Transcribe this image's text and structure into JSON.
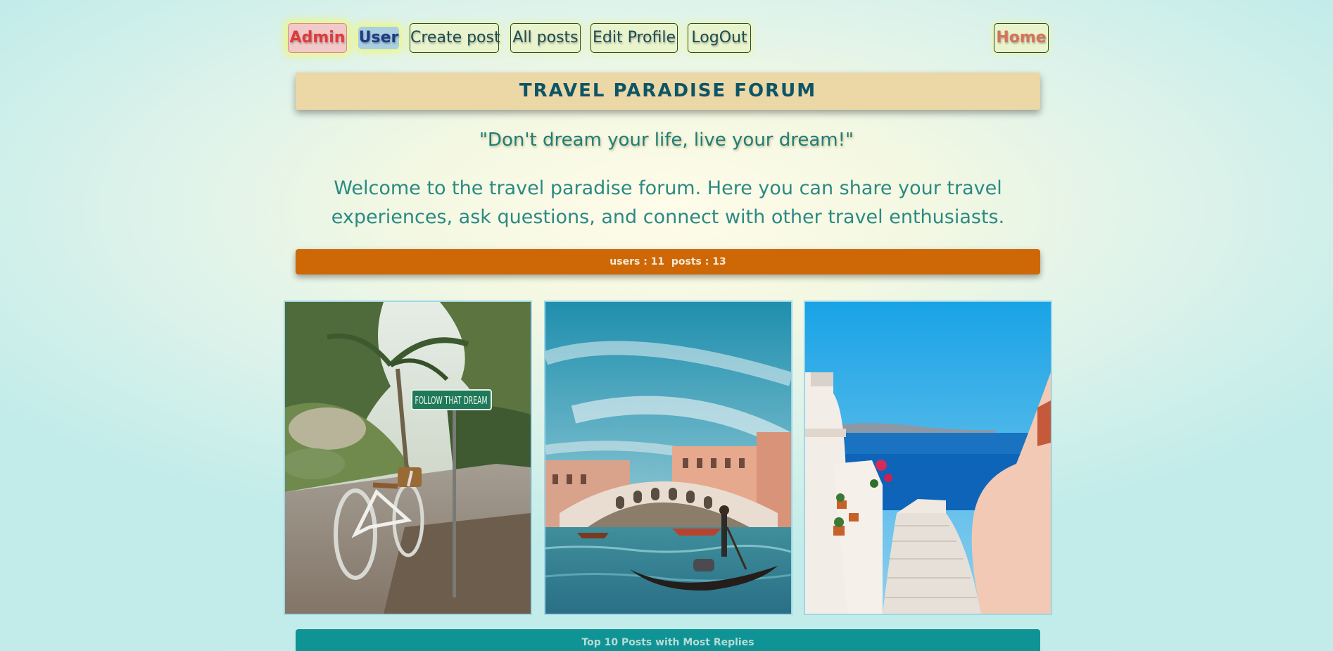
{
  "nav": {
    "admin": "Admin",
    "user": "User",
    "create_post": "Create post",
    "all_posts": "All posts",
    "edit_profile": "Edit Profile",
    "logout": "LogOut",
    "home": "Home"
  },
  "header": {
    "title": "TRAVEL PARADISE FORUM",
    "motto": "\"Don't dream your life, live your dream!\"",
    "welcome": "Welcome to the travel paradise forum. Here you can share your travel experiences, ask questions, and connect with other travel enthusiasts."
  },
  "stats": {
    "text": "users : 11  posts : 13",
    "users": 11,
    "posts": 13
  },
  "gallery": {
    "photo1_sign": "FOLLOW THAT DREAM"
  },
  "sections": {
    "top_posts_title": "Top 10 Posts with Most Replies"
  },
  "colors": {
    "title_bar": "#ecd7a6",
    "stats_bar": "#ce6806",
    "top_posts_bar": "#0f9394",
    "admin_text": "#de3b3b",
    "home_text": "#d4735a"
  }
}
